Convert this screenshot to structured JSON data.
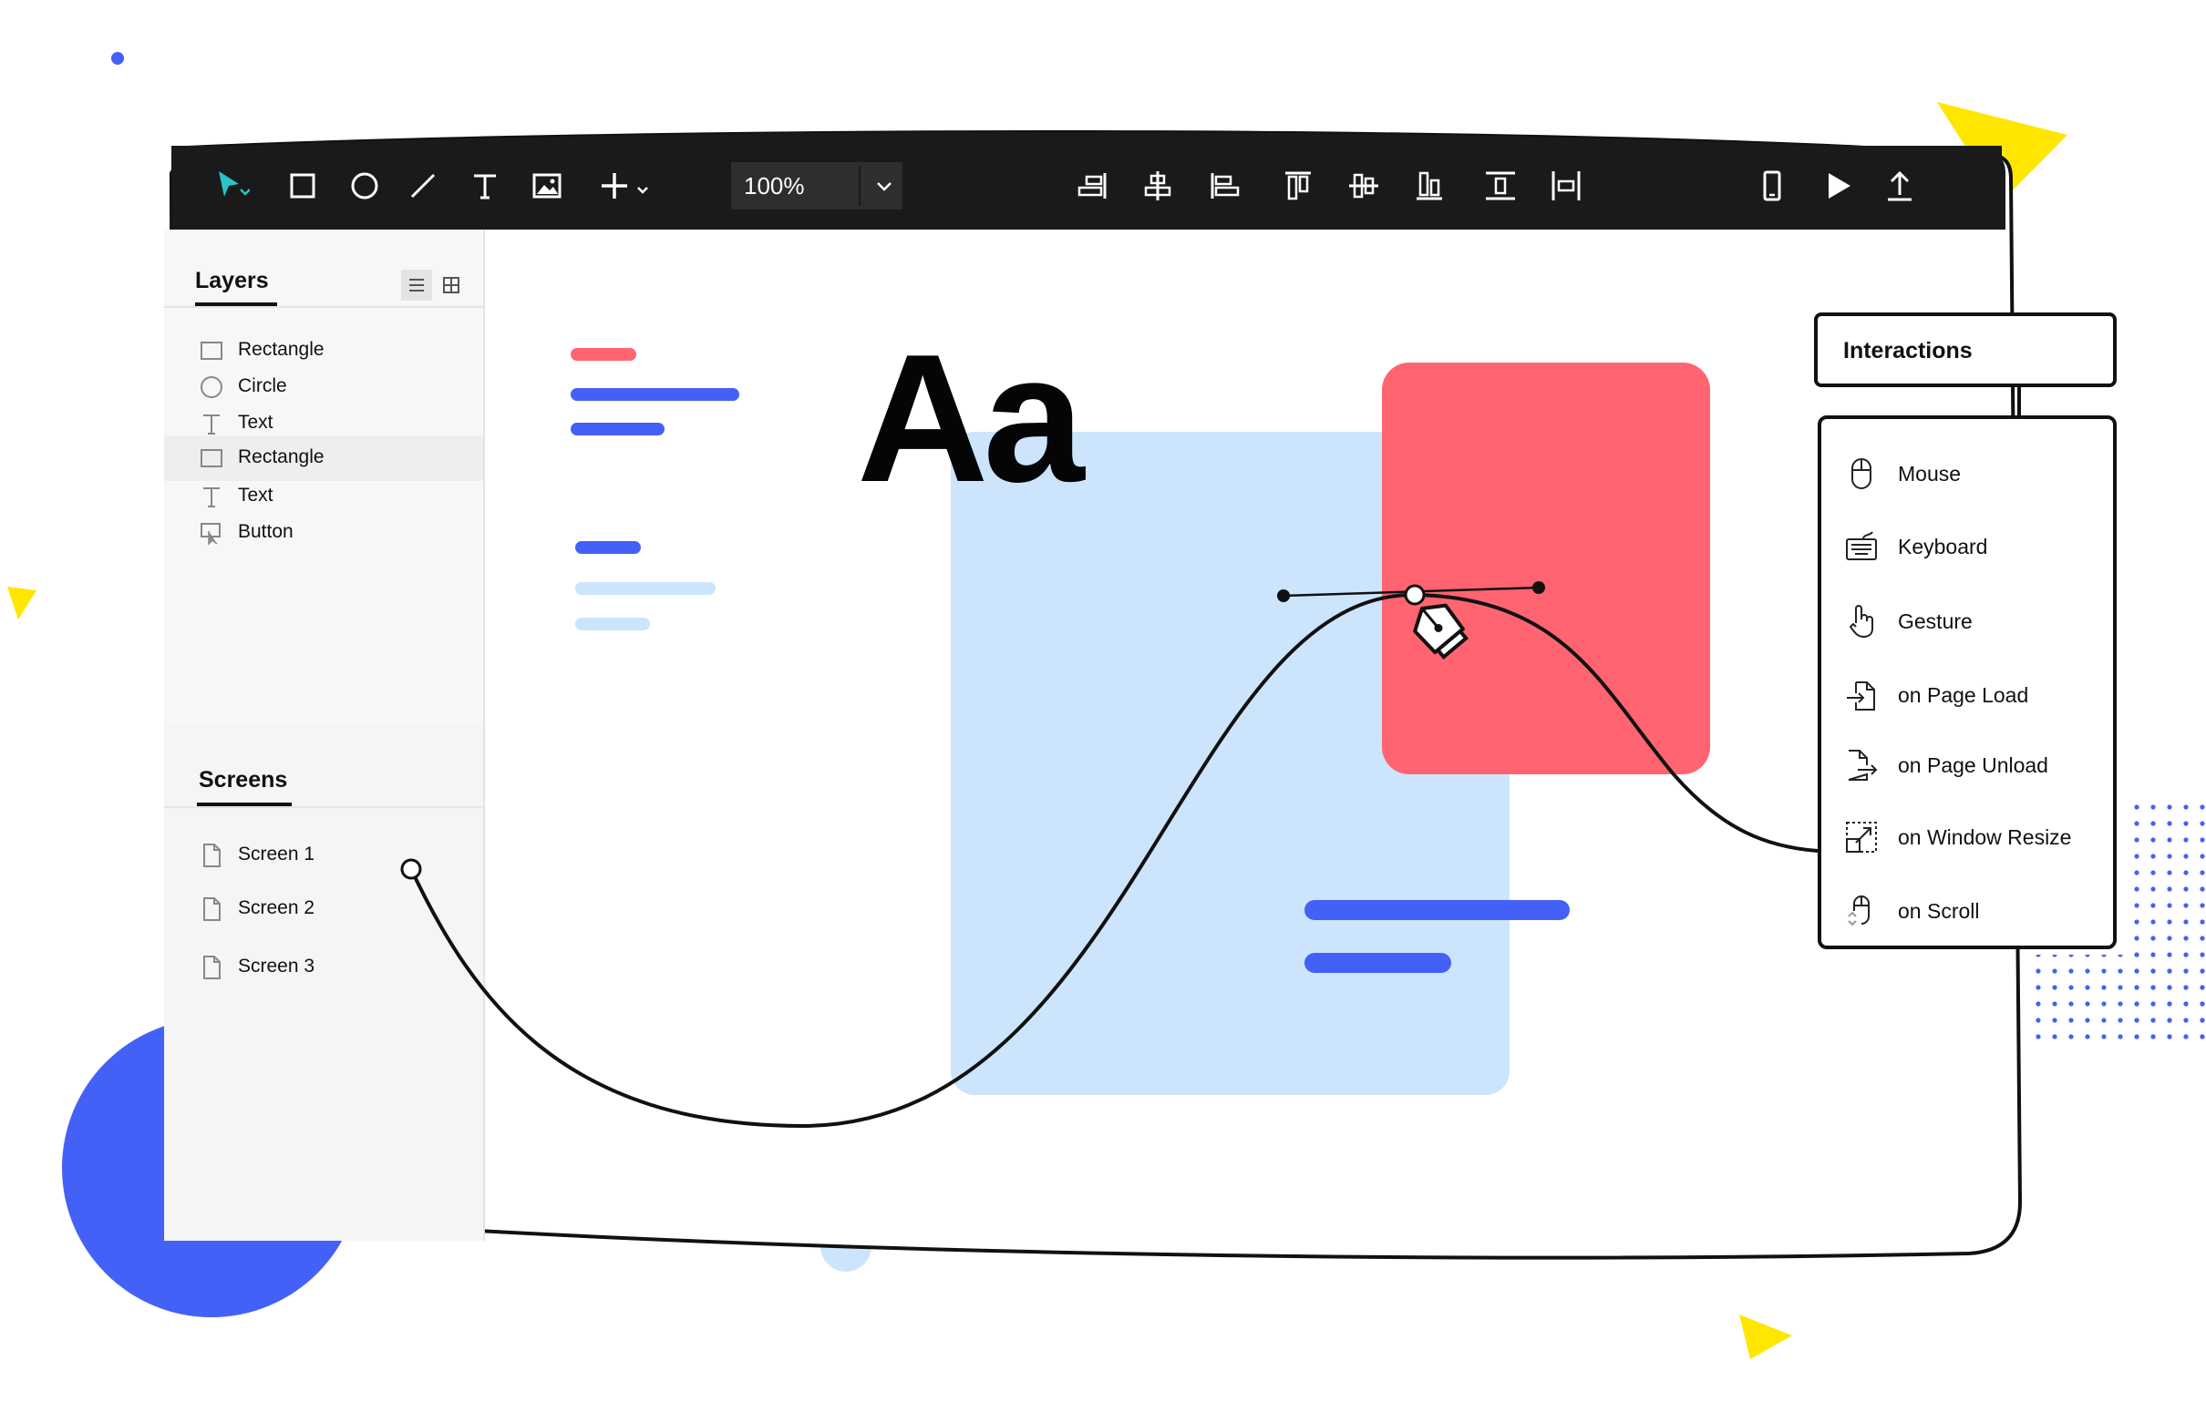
{
  "colors": {
    "toolbar_bg": "#1a1a1a",
    "accent_blue": "#4361f6",
    "accent_red": "#ff6470",
    "light_blue": "#cce5fd",
    "yellow": "#ffe600",
    "cursor_teal": "#29c4c4"
  },
  "toolbar": {
    "tools": [
      "select-tool",
      "rectangle-tool",
      "ellipse-tool",
      "line-tool",
      "text-tool",
      "image-tool",
      "add-tool"
    ],
    "zoom_value": "100%",
    "align_tools": [
      "align-right",
      "align-center-horizontal",
      "align-left",
      "align-top",
      "align-middle-vertical",
      "align-bottom",
      "distribute-vertical",
      "distribute-horizontal"
    ],
    "actions": [
      "device-preview",
      "play",
      "export"
    ]
  },
  "layers": {
    "title": "Layers",
    "items": [
      {
        "label": "Rectangle",
        "icon": "rectangle-icon",
        "selected": false
      },
      {
        "label": "Circle",
        "icon": "circle-icon",
        "selected": false
      },
      {
        "label": "Text",
        "icon": "text-icon",
        "selected": false
      },
      {
        "label": "Rectangle",
        "icon": "rectangle-icon",
        "selected": true
      },
      {
        "label": "Text",
        "icon": "text-icon",
        "selected": false
      },
      {
        "label": "Button",
        "icon": "button-icon",
        "selected": false
      }
    ]
  },
  "screens": {
    "title": "Screens",
    "items": [
      {
        "label": "Screen 1",
        "icon": "page-icon"
      },
      {
        "label": "Screen 2",
        "icon": "page-icon"
      },
      {
        "label": "Screen 3",
        "icon": "page-icon"
      }
    ]
  },
  "canvas": {
    "typography_sample": "Aa"
  },
  "interactions": {
    "title": "Interactions",
    "items": [
      {
        "label": "Mouse",
        "icon": "mouse-icon"
      },
      {
        "label": "Keyboard",
        "icon": "keyboard-icon"
      },
      {
        "label": "Gesture",
        "icon": "hand-pointer-icon"
      },
      {
        "label": "on Page Load",
        "icon": "page-load-icon"
      },
      {
        "label": "on Page Unload",
        "icon": "page-unload-icon"
      },
      {
        "label": "on Window Resize",
        "icon": "window-resize-icon"
      },
      {
        "label": "on Scroll",
        "icon": "scroll-icon"
      }
    ]
  }
}
